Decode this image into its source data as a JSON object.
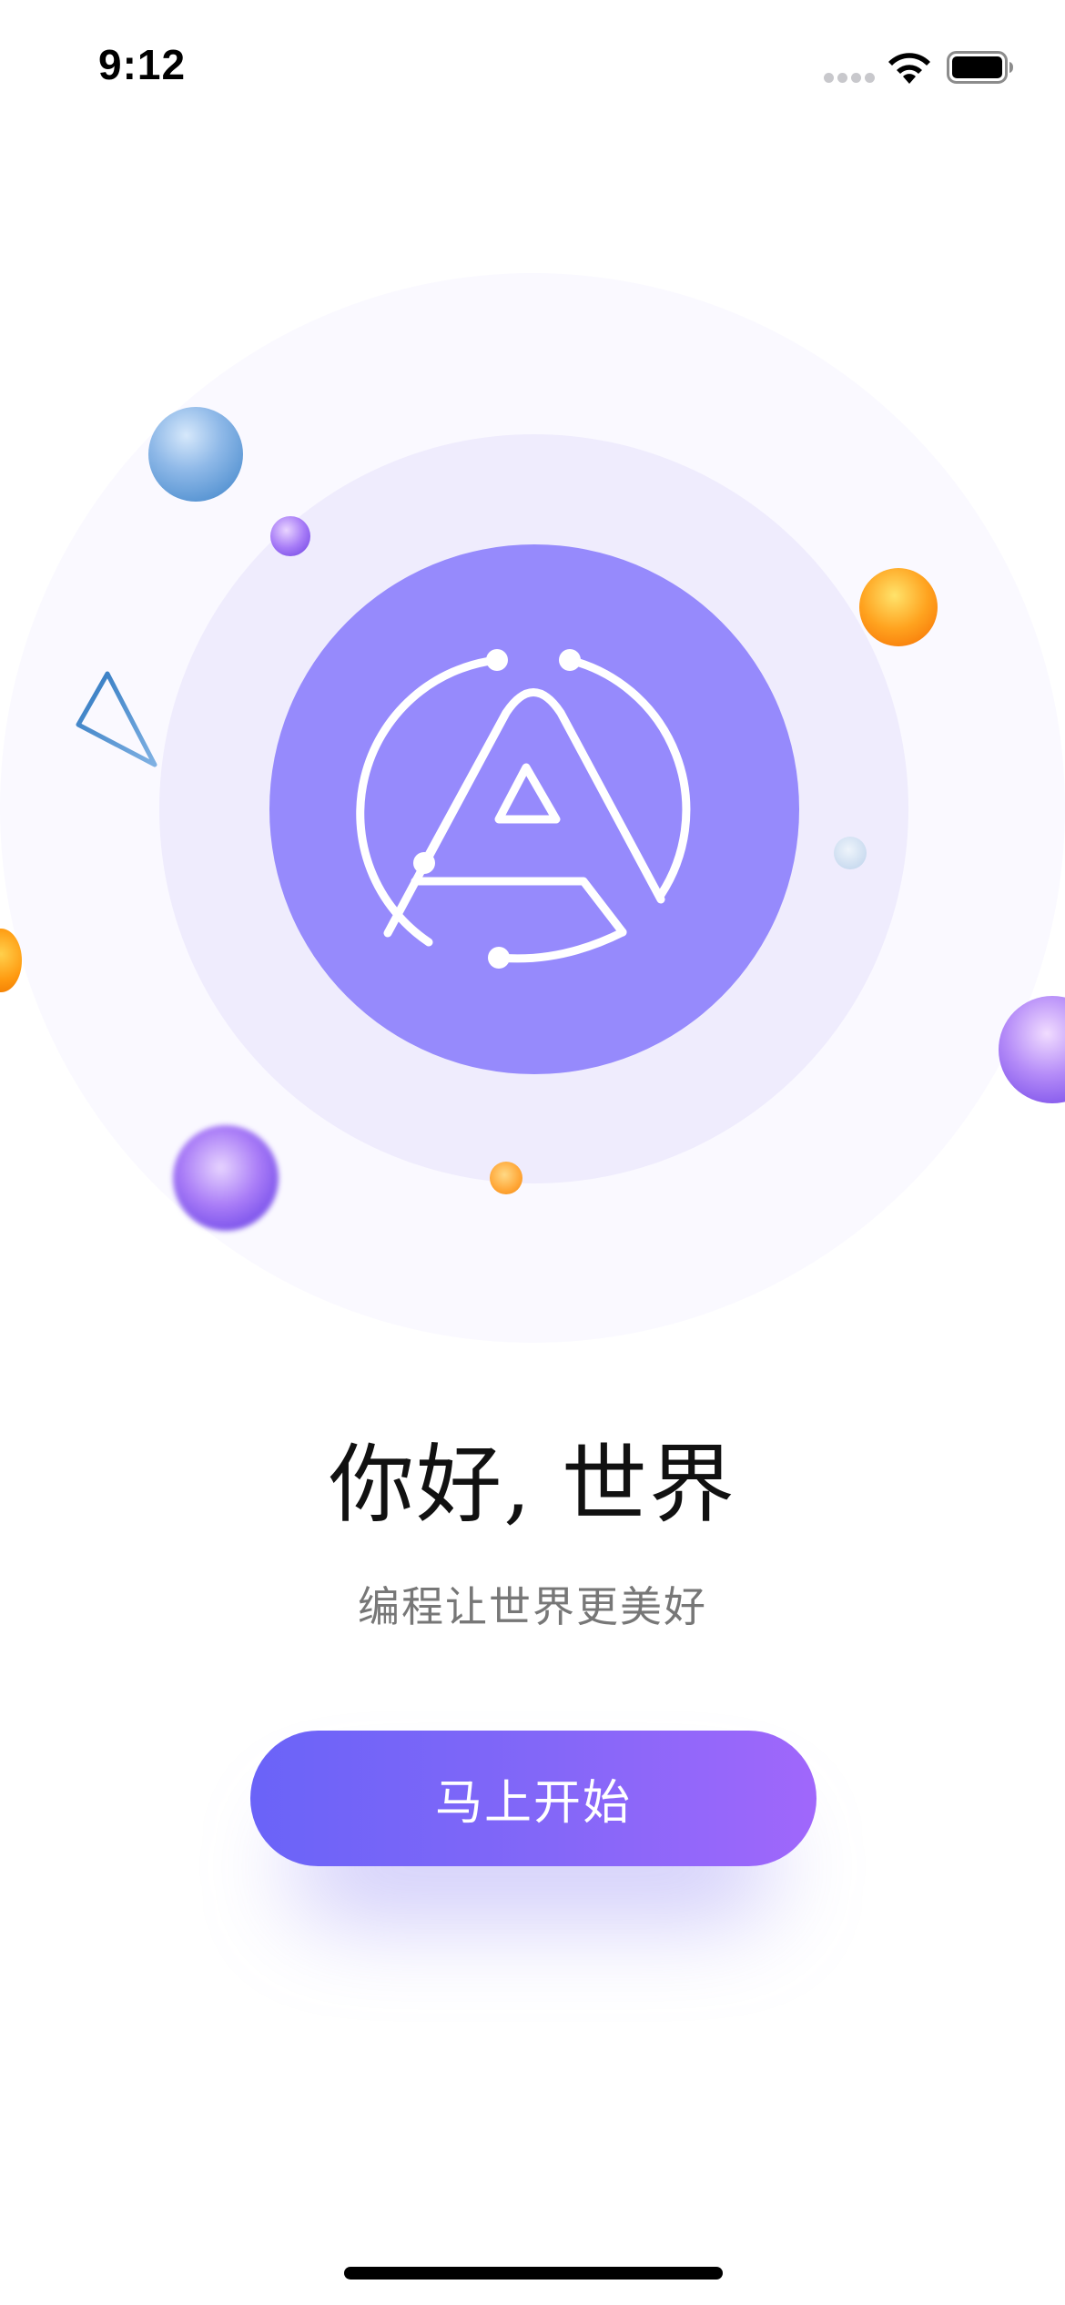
{
  "status_bar": {
    "time": "9:12"
  },
  "hero": {
    "logo_icon": "circuit-letter-a-icon",
    "colors": {
      "logo_fill": "#968afc",
      "ring_middle": "#efecfd",
      "ring_outer": "#faf9ff"
    }
  },
  "welcome": {
    "title": "你好, 世界",
    "subtitle": "编程让世界更美好"
  },
  "actions": {
    "start_label": "马上开始",
    "colors": {
      "gradient_start": "#6a63f8",
      "gradient_end": "#a067fb"
    }
  }
}
